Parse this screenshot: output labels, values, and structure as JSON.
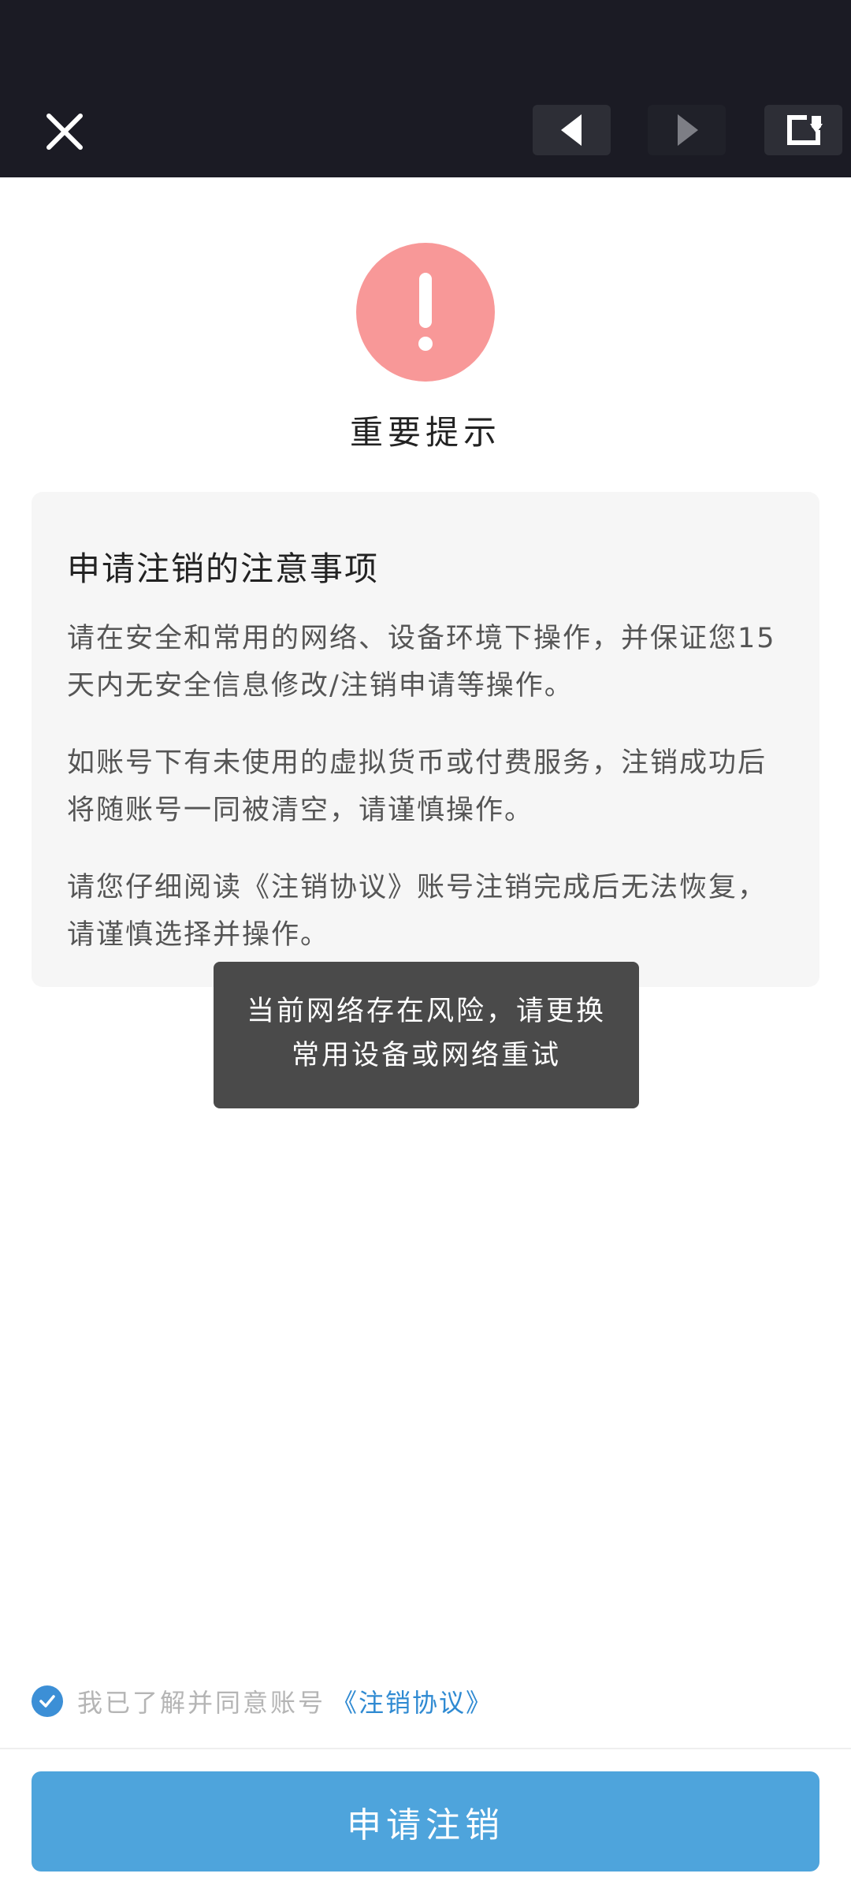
{
  "header": {
    "close_icon": "close-icon",
    "back_icon": "back-triangle-icon",
    "forward_icon": "forward-triangle-icon",
    "refresh_icon": "refresh-icon"
  },
  "alert": {
    "icon": "exclamation-icon",
    "color": "#f89898",
    "title": "重要提示"
  },
  "notice": {
    "heading": "申请注销的注意事项",
    "paragraphs": [
      "请在安全和常用的网络、设备环境下操作，并保证您15天内无安全信息修改/注销申请等操作。",
      "如账号下有未使用的虚拟货币或付费服务，注销成功后将随账号一同被清空，请谨慎操作。",
      "请您仔细阅读《注销协议》账号注销完成后无法恢复，请谨慎选择并操作。"
    ]
  },
  "toast": {
    "line1": "当前网络存在风险，请更换",
    "line2": "常用设备或网络重试"
  },
  "agreement": {
    "checked": true,
    "text": "我已了解并同意账号",
    "link": "《注销协议》",
    "accent": "#2f8ad2"
  },
  "actions": {
    "apply_label": "申请注销",
    "apply_color": "#4ea4dc"
  }
}
